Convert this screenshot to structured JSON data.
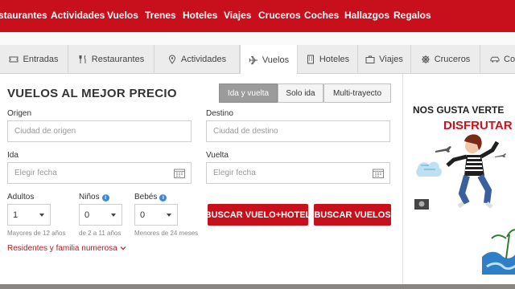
{
  "topnav": {
    "items": [
      "staurantes",
      "Actividades",
      "Vuelos",
      "Trenes",
      "Hoteles",
      "Viajes",
      "Cruceros",
      "Coches",
      "Hallazgos",
      "Regalos"
    ]
  },
  "tabs": [
    {
      "label": "Entradas",
      "icon": "ticket-icon"
    },
    {
      "label": "Restaurantes",
      "icon": "fork-knife-icon"
    },
    {
      "label": "Actividades",
      "icon": "map-pin-icon"
    },
    {
      "label": "Vuelos",
      "icon": "plane-icon"
    },
    {
      "label": "Hoteles",
      "icon": "hotel-icon"
    },
    {
      "label": "Viajes",
      "icon": "suitcase-icon"
    },
    {
      "label": "Cruceros",
      "icon": "ship-wheel-icon"
    },
    {
      "label": "Co",
      "icon": "car-icon"
    }
  ],
  "search": {
    "title": "VUELOS AL MEJOR PRECIO",
    "trip_types": [
      "Ida y vuelta",
      "Solo ida",
      "Multi-trayecto"
    ],
    "origin_label": "Origen",
    "origin_placeholder": "Ciudad de origen",
    "destination_label": "Destino",
    "destination_placeholder": "Ciudad de destino",
    "depart_label": "Ida",
    "depart_placeholder": "Elegir fecha",
    "return_label": "Vuelta",
    "return_placeholder": "Elegir fecha",
    "adults_label": "Adultos",
    "adults_value": "1",
    "adults_hint": "Mayores de 12 años",
    "children_label": "Niños",
    "children_value": "0",
    "children_hint": "de 2 a 11 años",
    "babies_label": "Bebés",
    "babies_value": "0",
    "babies_hint": "Menores de 24 meses",
    "btn_flight_hotel": "BUSCAR VUELO+HOTEL",
    "btn_flights": "BUSCAR VUELOS",
    "residents_link": "Residentes y familia numerosa"
  },
  "banner": {
    "line1": "NOS GUSTA VERTE",
    "line2": "DISFRUTAR"
  },
  "colors": {
    "brand": "#c8101d",
    "active_segment": "#9b9b9b"
  }
}
